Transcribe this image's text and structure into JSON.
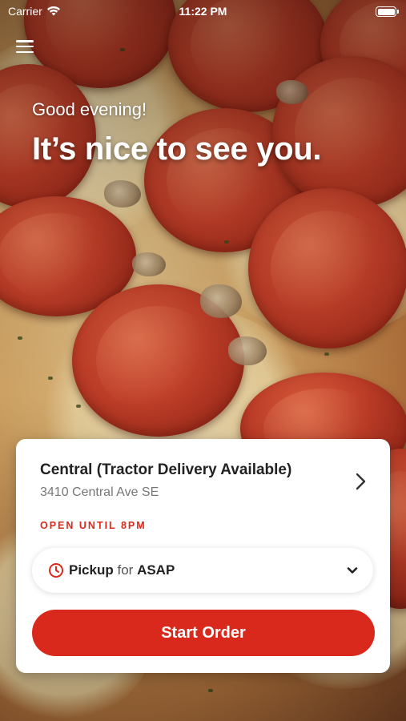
{
  "status_bar": {
    "carrier": "Carrier",
    "time": "11:22 PM"
  },
  "greeting": {
    "small": "Good evening!",
    "large": "It’s nice to see you."
  },
  "location_card": {
    "name": "Central (Tractor Delivery Available)",
    "address": "3410 Central Ave SE",
    "hours": "OPEN UNTIL 8PM"
  },
  "order_mode": {
    "mode": "Pickup",
    "connector": "for",
    "time": "ASAP"
  },
  "start_button": {
    "label": "Start Order"
  },
  "colors": {
    "accent": "#d8291c",
    "text_dark": "#222222",
    "text_muted": "#777777"
  },
  "icons": [
    "menu-icon",
    "wifi-icon",
    "battery-icon",
    "chevron-right-icon",
    "clock-icon",
    "chevron-down-icon"
  ]
}
